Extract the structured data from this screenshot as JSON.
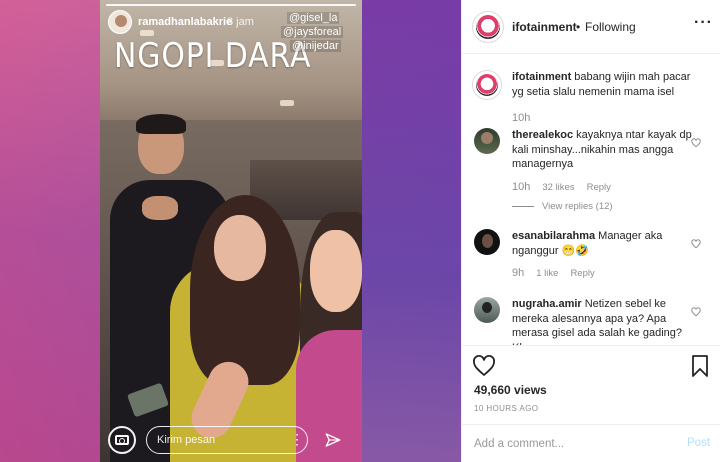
{
  "story": {
    "username": "ramadhanlabakrie",
    "time": "8 jam",
    "caption": "NGOPI DARA",
    "mentions": [
      "@gisel_la",
      "@jaysforeal",
      "@inijedar"
    ],
    "reply_placeholder": "Kirim pesan"
  },
  "header": {
    "username": "ifotainment",
    "separator": "•",
    "follow_status": "Following",
    "more": "···"
  },
  "comments": [
    {
      "username": "ifotainment",
      "text": "babang wijin mah pacar yg setia slalu nemenin mama isel",
      "time": "10h"
    },
    {
      "username": "therealekoc",
      "text": "kayaknya ntar kayak dp kali minshay...nikahin mas angga managernya",
      "time": "10h",
      "likes": "32 likes",
      "reply": "Reply",
      "view_replies": "View replies (12)"
    },
    {
      "username": "esanabilarahma",
      "text": "Manager aka nganggur 😁🤣",
      "time": "9h",
      "likes": "1 like",
      "reply": "Reply"
    },
    {
      "username": "nugraha.amir",
      "text": "Netizen sebel ke mereka alesannya apa ya? Apa merasa gisel ada salah ke gading? Kl...",
      "time": ""
    }
  ],
  "post": {
    "views": "49,660 views",
    "time": "10 HOURS AGO"
  },
  "comment_box": {
    "placeholder": "Add a comment...",
    "post_label": "Post"
  },
  "colors": {
    "accent_blue_disabled": "#b2dffc",
    "secondary_text": "#8e8e8e",
    "border": "#efefef"
  }
}
